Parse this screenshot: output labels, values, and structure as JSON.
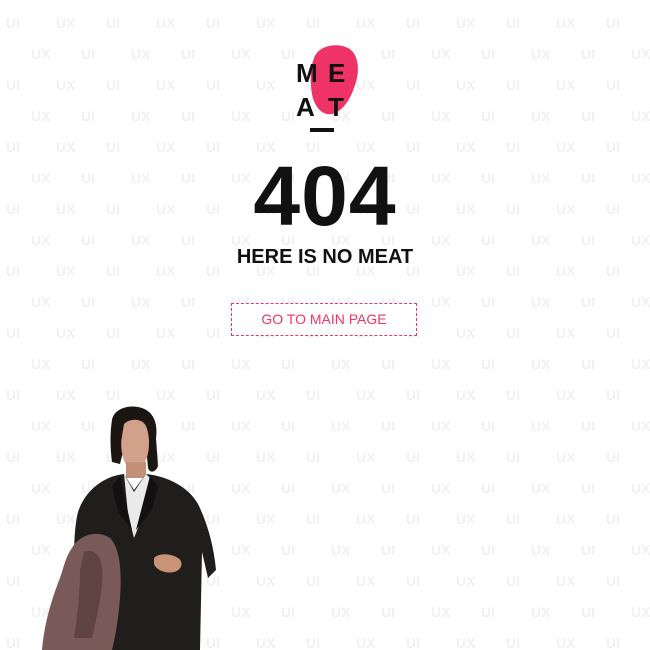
{
  "background": {
    "pattern_words": [
      "UI",
      "UX"
    ],
    "pattern_color": "#f1f1f1"
  },
  "logo": {
    "row1": [
      "M",
      "E"
    ],
    "row2": [
      "A",
      "T"
    ],
    "blob_color": "#ee3466"
  },
  "error": {
    "code": "404",
    "message": "HERE IS NO MEAT"
  },
  "actions": {
    "main_page_label": "GO TO MAIN PAGE",
    "accent_color": "#ee3466"
  },
  "illustration": {
    "icon": "confused-man-illustration"
  }
}
